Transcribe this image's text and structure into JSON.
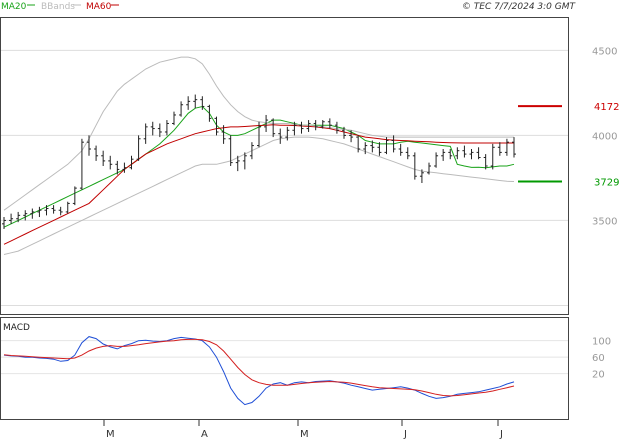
{
  "header": {
    "legend": [
      {
        "label": "MA20",
        "color": "#1aa31a"
      },
      {
        "label": "BBands",
        "color": "#bbbbbb"
      },
      {
        "label": "MA60",
        "color": "#c00000"
      }
    ],
    "stamp": "© TEC 7/7/2024 3:0 GMT"
  },
  "chart_data": [
    {
      "type": "line",
      "panel": "price",
      "y_ticks": [
        {
          "label": "4500",
          "value": 4500
        },
        {
          "label": "4000",
          "value": 4000
        },
        {
          "label": "3500",
          "value": 3500
        }
      ],
      "ylim": [
        2950,
        4690
      ],
      "x_ticks": [
        "M",
        "A",
        "M",
        "J",
        "J"
      ],
      "signals": [
        {
          "label": "4172",
          "value": 4172,
          "color": "#cc0000"
        },
        {
          "label": "3729",
          "value": 3729,
          "color": "#009900"
        }
      ],
      "series": [
        {
          "name": "MA20",
          "color": "#1aa31a",
          "values": [
            3460,
            3480,
            3500,
            3520,
            3540,
            3560,
            3580,
            3600,
            3620,
            3640,
            3660,
            3680,
            3700,
            3720,
            3740,
            3760,
            3780,
            3800,
            3830,
            3860,
            3890,
            3920,
            3950,
            3990,
            4030,
            4080,
            4130,
            4160,
            4170,
            4130,
            4060,
            4020,
            4000,
            4000,
            4010,
            4030,
            4050,
            4070,
            4090,
            4090,
            4080,
            4070,
            4060,
            4060,
            4060,
            4060,
            4060,
            4050,
            4040,
            4020,
            4000,
            3970,
            3960,
            3950,
            3950,
            3950,
            3960,
            3965,
            3960,
            3955,
            3950,
            3945,
            3940,
            3935,
            3830,
            3820,
            3812,
            3813,
            3810,
            3815,
            3820,
            3820,
            3830
          ]
        },
        {
          "name": "MA60",
          "color": "#c00000",
          "values": [
            3360,
            3380,
            3400,
            3420,
            3440,
            3460,
            3480,
            3500,
            3520,
            3540,
            3560,
            3580,
            3600,
            3640,
            3680,
            3720,
            3760,
            3800,
            3830,
            3860,
            3890,
            3910,
            3930,
            3950,
            3965,
            3980,
            3995,
            4010,
            4020,
            4030,
            4040,
            4045,
            4050,
            4050,
            4052,
            4055,
            4058,
            4060,
            4062,
            4060,
            4060,
            4058,
            4055,
            4053,
            4050,
            4045,
            4040,
            4030,
            4020,
            4010,
            4000,
            3990,
            3985,
            3980,
            3975,
            3972,
            3970,
            3968,
            3966,
            3964,
            3962,
            3960,
            3958,
            3957,
            3956,
            3955,
            3955,
            3955,
            3955,
            3955,
            3955,
            3955,
            3955
          ]
        },
        {
          "name": "BBands upper",
          "color": "#bbbbbb",
          "values": [
            3560,
            3590,
            3620,
            3650,
            3680,
            3710,
            3740,
            3770,
            3800,
            3830,
            3870,
            3910,
            3980,
            4060,
            4140,
            4200,
            4260,
            4300,
            4330,
            4360,
            4390,
            4410,
            4430,
            4440,
            4450,
            4460,
            4460,
            4450,
            4420,
            4360,
            4290,
            4230,
            4180,
            4140,
            4110,
            4090,
            4080,
            4075,
            4070,
            4070,
            4070,
            4065,
            4060,
            4060,
            4055,
            4050,
            4045,
            4040,
            4035,
            4030,
            4020,
            4010,
            4000,
            3995,
            3990,
            3990,
            3990,
            3990,
            3990,
            3990,
            3990,
            3990,
            3990,
            3990,
            3990,
            3990,
            3990,
            3990,
            3990,
            3990,
            3990,
            3990,
            3990
          ]
        },
        {
          "name": "BBands lower",
          "color": "#bbbbbb",
          "values": [
            3300,
            3310,
            3320,
            3340,
            3360,
            3380,
            3400,
            3420,
            3440,
            3460,
            3480,
            3500,
            3520,
            3540,
            3560,
            3580,
            3600,
            3620,
            3640,
            3660,
            3680,
            3700,
            3720,
            3740,
            3760,
            3780,
            3800,
            3820,
            3830,
            3830,
            3830,
            3840,
            3850,
            3870,
            3890,
            3910,
            3930,
            3950,
            3970,
            3980,
            3985,
            3990,
            3990,
            3990,
            3985,
            3980,
            3970,
            3960,
            3950,
            3935,
            3920,
            3905,
            3890,
            3875,
            3860,
            3845,
            3830,
            3815,
            3800,
            3790,
            3785,
            3780,
            3775,
            3770,
            3765,
            3760,
            3755,
            3750,
            3745,
            3740,
            3735,
            3730,
            3729
          ]
        }
      ],
      "candles": [
        {
          "o": 3480,
          "h": 3520,
          "l": 3450,
          "c": 3500
        },
        {
          "o": 3500,
          "h": 3540,
          "l": 3480,
          "c": 3510
        },
        {
          "o": 3510,
          "h": 3550,
          "l": 3490,
          "c": 3530
        },
        {
          "o": 3530,
          "h": 3560,
          "l": 3500,
          "c": 3540
        },
        {
          "o": 3540,
          "h": 3570,
          "l": 3510,
          "c": 3550
        },
        {
          "o": 3550,
          "h": 3580,
          "l": 3520,
          "c": 3560
        },
        {
          "o": 3560,
          "h": 3590,
          "l": 3530,
          "c": 3570
        },
        {
          "o": 3570,
          "h": 3590,
          "l": 3540,
          "c": 3560
        },
        {
          "o": 3560,
          "h": 3580,
          "l": 3530,
          "c": 3550
        },
        {
          "o": 3550,
          "h": 3610,
          "l": 3540,
          "c": 3600
        },
        {
          "o": 3600,
          "h": 3700,
          "l": 3590,
          "c": 3690
        },
        {
          "o": 3690,
          "h": 3980,
          "l": 3680,
          "c": 3960
        },
        {
          "o": 3960,
          "h": 4000,
          "l": 3880,
          "c": 3920
        },
        {
          "o": 3920,
          "h": 3940,
          "l": 3850,
          "c": 3880
        },
        {
          "o": 3880,
          "h": 3910,
          "l": 3820,
          "c": 3850
        },
        {
          "o": 3850,
          "h": 3880,
          "l": 3800,
          "c": 3830
        },
        {
          "o": 3830,
          "h": 3850,
          "l": 3770,
          "c": 3800
        },
        {
          "o": 3800,
          "h": 3840,
          "l": 3780,
          "c": 3810
        },
        {
          "o": 3810,
          "h": 3880,
          "l": 3800,
          "c": 3860
        },
        {
          "o": 3860,
          "h": 4000,
          "l": 3850,
          "c": 3980
        },
        {
          "o": 3980,
          "h": 4070,
          "l": 3950,
          "c": 4050
        },
        {
          "o": 4050,
          "h": 4080,
          "l": 4000,
          "c": 4040
        },
        {
          "o": 4040,
          "h": 4070,
          "l": 3990,
          "c": 4020
        },
        {
          "o": 4020,
          "h": 4090,
          "l": 4000,
          "c": 4070
        },
        {
          "o": 4070,
          "h": 4140,
          "l": 4060,
          "c": 4120
        },
        {
          "o": 4120,
          "h": 4200,
          "l": 4110,
          "c": 4180
        },
        {
          "o": 4180,
          "h": 4230,
          "l": 4150,
          "c": 4200
        },
        {
          "o": 4200,
          "h": 4240,
          "l": 4160,
          "c": 4210
        },
        {
          "o": 4210,
          "h": 4230,
          "l": 4150,
          "c": 4170
        },
        {
          "o": 4170,
          "h": 4180,
          "l": 4080,
          "c": 4100
        },
        {
          "o": 4100,
          "h": 4110,
          "l": 4000,
          "c": 4020
        },
        {
          "o": 4020,
          "h": 4060,
          "l": 3950,
          "c": 3980
        },
        {
          "o": 3980,
          "h": 4000,
          "l": 3820,
          "c": 3840
        },
        {
          "o": 3840,
          "h": 3880,
          "l": 3790,
          "c": 3850
        },
        {
          "o": 3850,
          "h": 3900,
          "l": 3800,
          "c": 3880
        },
        {
          "o": 3880,
          "h": 3960,
          "l": 3860,
          "c": 3940
        },
        {
          "o": 3940,
          "h": 4080,
          "l": 3930,
          "c": 4050
        },
        {
          "o": 4050,
          "h": 4120,
          "l": 4020,
          "c": 4090
        },
        {
          "o": 4090,
          "h": 4100,
          "l": 3990,
          "c": 4010
        },
        {
          "o": 4010,
          "h": 4040,
          "l": 3950,
          "c": 3990
        },
        {
          "o": 3990,
          "h": 4050,
          "l": 3970,
          "c": 4030
        },
        {
          "o": 4030,
          "h": 4080,
          "l": 4000,
          "c": 4060
        },
        {
          "o": 4060,
          "h": 4080,
          "l": 4010,
          "c": 4040
        },
        {
          "o": 4040,
          "h": 4090,
          "l": 4020,
          "c": 4070
        },
        {
          "o": 4070,
          "h": 4090,
          "l": 4030,
          "c": 4050
        },
        {
          "o": 4050,
          "h": 4090,
          "l": 4040,
          "c": 4080
        },
        {
          "o": 4080,
          "h": 4100,
          "l": 4040,
          "c": 4060
        },
        {
          "o": 4060,
          "h": 4080,
          "l": 4010,
          "c": 4030
        },
        {
          "o": 4030,
          "h": 4050,
          "l": 3980,
          "c": 4000
        },
        {
          "o": 4000,
          "h": 4030,
          "l": 3960,
          "c": 3990
        },
        {
          "o": 3990,
          "h": 4000,
          "l": 3900,
          "c": 3920
        },
        {
          "o": 3920,
          "h": 3960,
          "l": 3890,
          "c": 3940
        },
        {
          "o": 3940,
          "h": 3970,
          "l": 3900,
          "c": 3930
        },
        {
          "o": 3930,
          "h": 3960,
          "l": 3880,
          "c": 3900
        },
        {
          "o": 3900,
          "h": 3990,
          "l": 3890,
          "c": 3970
        },
        {
          "o": 3970,
          "h": 4000,
          "l": 3900,
          "c": 3920
        },
        {
          "o": 3920,
          "h": 3950,
          "l": 3880,
          "c": 3900
        },
        {
          "o": 3900,
          "h": 3930,
          "l": 3860,
          "c": 3880
        },
        {
          "o": 3880,
          "h": 3900,
          "l": 3740,
          "c": 3760
        },
        {
          "o": 3760,
          "h": 3800,
          "l": 3720,
          "c": 3780
        },
        {
          "o": 3780,
          "h": 3840,
          "l": 3770,
          "c": 3820
        },
        {
          "o": 3820,
          "h": 3900,
          "l": 3810,
          "c": 3880
        },
        {
          "o": 3880,
          "h": 3920,
          "l": 3850,
          "c": 3900
        },
        {
          "o": 3900,
          "h": 3920,
          "l": 3860,
          "c": 3880
        },
        {
          "o": 3880,
          "h": 3930,
          "l": 3860,
          "c": 3910
        },
        {
          "o": 3910,
          "h": 3940,
          "l": 3870,
          "c": 3890
        },
        {
          "o": 3890,
          "h": 3920,
          "l": 3860,
          "c": 3900
        },
        {
          "o": 3900,
          "h": 3930,
          "l": 3860,
          "c": 3870
        },
        {
          "o": 3870,
          "h": 3890,
          "l": 3800,
          "c": 3820
        },
        {
          "o": 3820,
          "h": 3950,
          "l": 3800,
          "c": 3930
        },
        {
          "o": 3930,
          "h": 3960,
          "l": 3880,
          "c": 3900
        },
        {
          "o": 3900,
          "h": 3980,
          "l": 3880,
          "c": 3960
        },
        {
          "o": 3960,
          "h": 3990,
          "l": 3870,
          "c": 3890
        }
      ]
    },
    {
      "type": "line",
      "panel": "macd",
      "title": "MACD",
      "y_ticks": [
        {
          "label": "100",
          "value": 100
        },
        {
          "label": "60",
          "value": 60
        },
        {
          "label": "20",
          "value": 20
        }
      ],
      "ylim": [
        -90,
        155
      ],
      "series": [
        {
          "name": "MACD",
          "color": "#1f4fd6",
          "values": [
            65,
            63,
            62,
            60,
            60,
            58,
            57,
            55,
            50,
            52,
            65,
            95,
            110,
            105,
            92,
            85,
            80,
            88,
            93,
            100,
            101,
            99,
            98,
            100,
            105,
            108,
            106,
            104,
            100,
            85,
            60,
            25,
            -15,
            -40,
            -55,
            -50,
            -35,
            -15,
            -5,
            -2,
            -8,
            -2,
            0,
            -2,
            1,
            2,
            3,
            0,
            -3,
            -8,
            -12,
            -16,
            -20,
            -18,
            -16,
            -14,
            -12,
            -15,
            -20,
            -28,
            -35,
            -40,
            -38,
            -35,
            -30,
            -28,
            -26,
            -24,
            -20,
            -16,
            -12,
            -5,
            0
          ]
        },
        {
          "name": "Signal",
          "color": "#d42020",
          "values": [
            66,
            64,
            63,
            62,
            61,
            60,
            59,
            58,
            57,
            56,
            58,
            65,
            75,
            82,
            86,
            88,
            86,
            86,
            88,
            90,
            93,
            95,
            97,
            99,
            100,
            102,
            103,
            103,
            102,
            98,
            90,
            75,
            55,
            35,
            18,
            5,
            -2,
            -6,
            -8,
            -8,
            -8,
            -6,
            -4,
            -2,
            -1,
            0,
            1,
            0,
            -1,
            -3,
            -6,
            -9,
            -12,
            -14,
            -15,
            -16,
            -17,
            -18,
            -19,
            -22,
            -26,
            -30,
            -33,
            -34,
            -33,
            -31,
            -29,
            -27,
            -25,
            -22,
            -18,
            -14,
            -10
          ]
        }
      ]
    }
  ]
}
